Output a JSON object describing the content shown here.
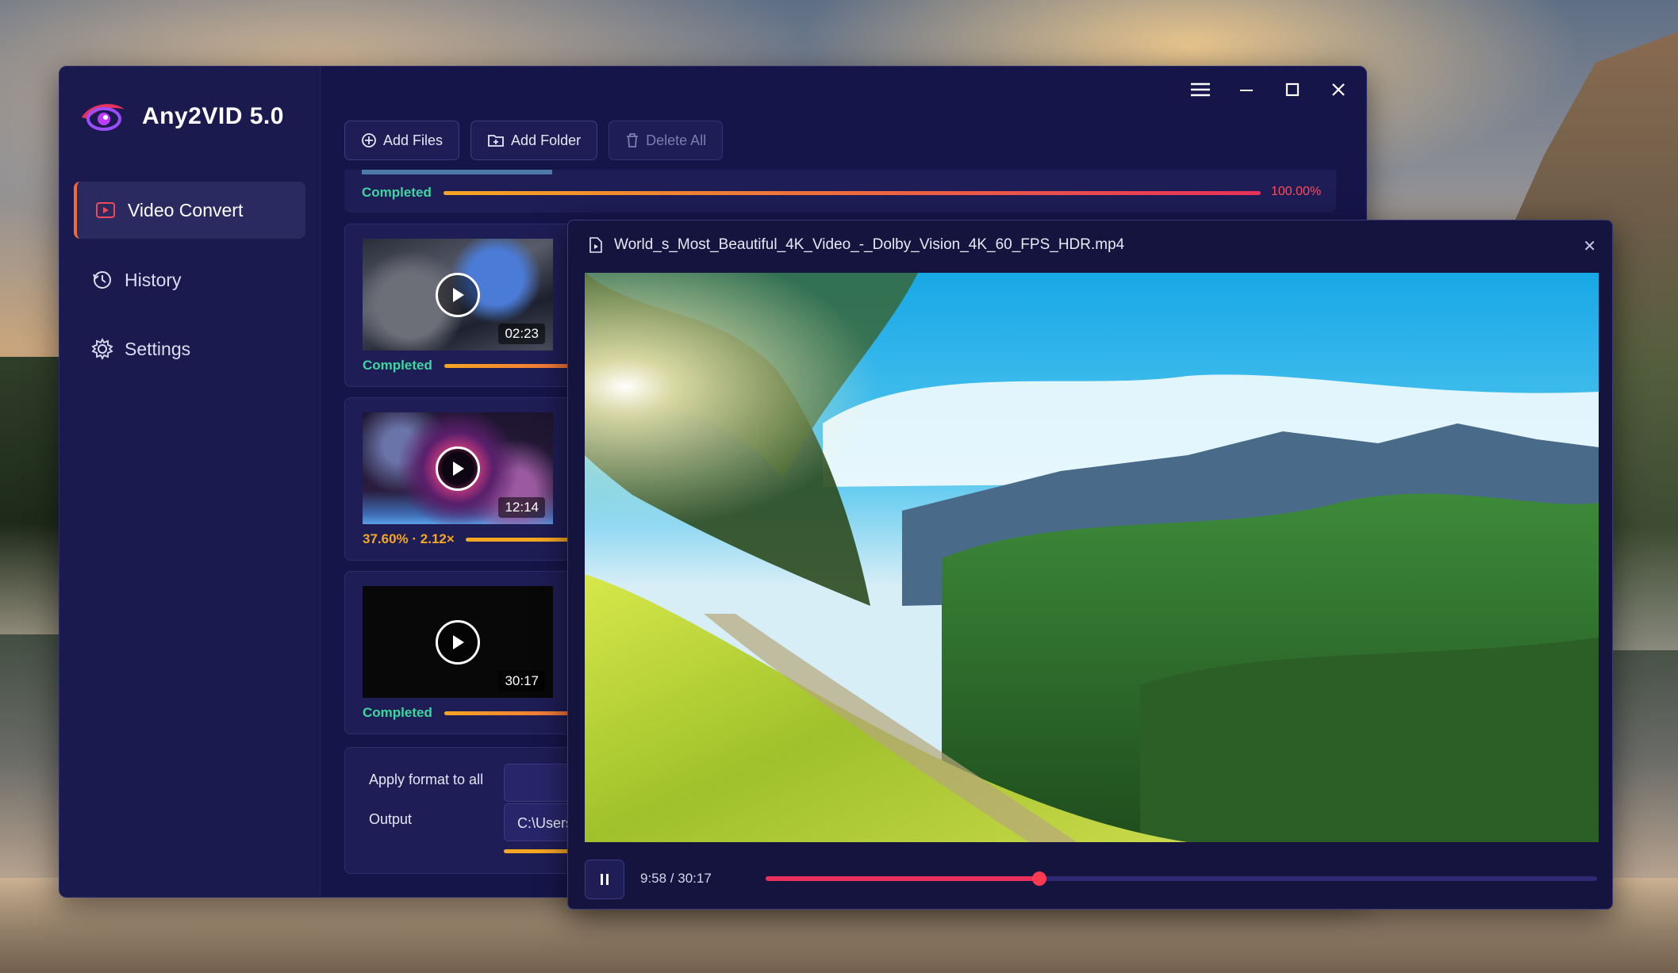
{
  "app": {
    "name": "Any2VID 5.0",
    "nav": [
      {
        "label": "Video Convert",
        "icon": "video-convert-icon",
        "active": true
      },
      {
        "label": "History",
        "icon": "history-icon",
        "active": false
      },
      {
        "label": "Settings",
        "icon": "settings-icon",
        "active": false
      }
    ],
    "toolbar": {
      "add_files": "Add Files",
      "add_folder": "Add Folder",
      "delete_all": "Delete All"
    },
    "tasks": [
      {
        "status": "Completed",
        "progress_label": "100.00%",
        "progress": 1.0
      },
      {
        "status": "Completed",
        "duration": "02:23",
        "progress": 1.0
      },
      {
        "status": "37.60% · 2.12×",
        "duration": "12:14",
        "progress": 0.376
      },
      {
        "status": "Completed",
        "duration": "30:17",
        "progress": 1.0
      }
    ],
    "bottom": {
      "apply_format_label": "Apply format to all",
      "output_label": "Output",
      "output_value": "C:\\Users"
    }
  },
  "preview": {
    "filename": "World_s_Most_Beautiful_4K_Video_-_Dolby_Vision_4K_60_FPS_HDR.mp4",
    "time": "9:58 / 30:17",
    "progress": 0.329
  },
  "colors": {
    "window_bg": "#16154a",
    "sidebar_bg": "#1b1a4f",
    "accent_orange": "#f06a3c",
    "completed_green": "#3fd6a0",
    "progress_start": "#f5a623",
    "progress_end": "#e8315c"
  }
}
